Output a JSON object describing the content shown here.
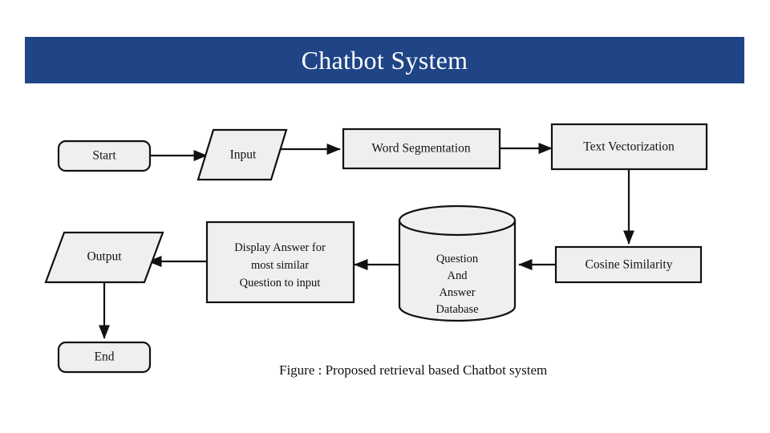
{
  "slide": {
    "title": "Chatbot System",
    "title_bg_color": "#1f4587",
    "title_text_color": "#ffffff",
    "background_color": "#ffffff"
  },
  "diagram": {
    "shape_fill_color": "#efefef",
    "shape_stroke_color": "#111111",
    "nodes": {
      "start": {
        "label": "Start",
        "shape": "rounded-rectangle"
      },
      "input": {
        "label": "Input",
        "shape": "parallelogram"
      },
      "word_segmentation": {
        "label": "Word Segmentation",
        "shape": "rectangle"
      },
      "text_vectorization": {
        "label": "Text Vectorization",
        "shape": "rectangle"
      },
      "cosine_similarity": {
        "label": "Cosine Similarity",
        "shape": "rectangle"
      },
      "database": {
        "shape": "cylinder",
        "line1": "Question",
        "line2": "And",
        "line3": "Answer",
        "line4": "Database"
      },
      "display_answer": {
        "shape": "rectangle",
        "line1": "Display Answer for",
        "line2": "most similar",
        "line3": "Question to input"
      },
      "output": {
        "label": "Output",
        "shape": "parallelogram"
      },
      "end": {
        "label": "End",
        "shape": "rounded-rectangle"
      }
    }
  },
  "caption": "Figure  : Proposed retrieval based Chatbot system"
}
